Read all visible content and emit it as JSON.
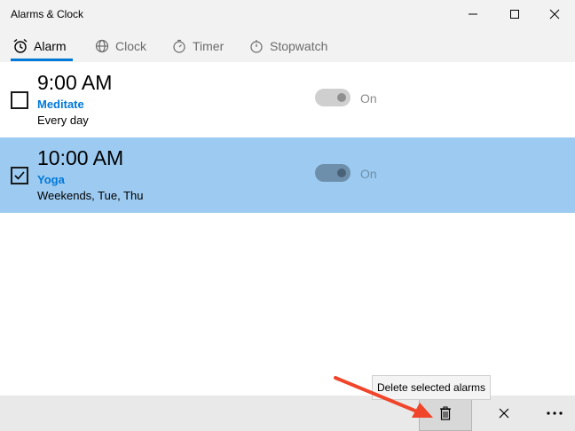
{
  "window": {
    "title": "Alarms & Clock",
    "minimize_icon": "minimize-icon",
    "maximize_icon": "maximize-icon",
    "close_icon": "close-icon"
  },
  "tabs": [
    {
      "label": "Alarm",
      "icon": "alarm-icon",
      "active": true
    },
    {
      "label": "Clock",
      "icon": "globe-icon",
      "active": false
    },
    {
      "label": "Timer",
      "icon": "timer-icon",
      "active": false
    },
    {
      "label": "Stopwatch",
      "icon": "stopwatch-icon",
      "active": false
    }
  ],
  "alarms": [
    {
      "time": "9:00 AM",
      "name": "Meditate",
      "repeat": "Every day",
      "toggle_label": "On",
      "checked": false
    },
    {
      "time": "10:00 AM",
      "name": "Yoga",
      "repeat": "Weekends, Tue, Thu",
      "toggle_label": "On",
      "checked": true
    }
  ],
  "command_bar": {
    "delete_icon": "trash-icon",
    "cancel_icon": "close-icon",
    "more_icon": "more-icon",
    "tooltip": "Delete selected alarms"
  },
  "annotation": {
    "arrow_color": "#f0452b"
  },
  "colors": {
    "accent": "#0078d7",
    "selected_row": "#9ccaf0"
  }
}
